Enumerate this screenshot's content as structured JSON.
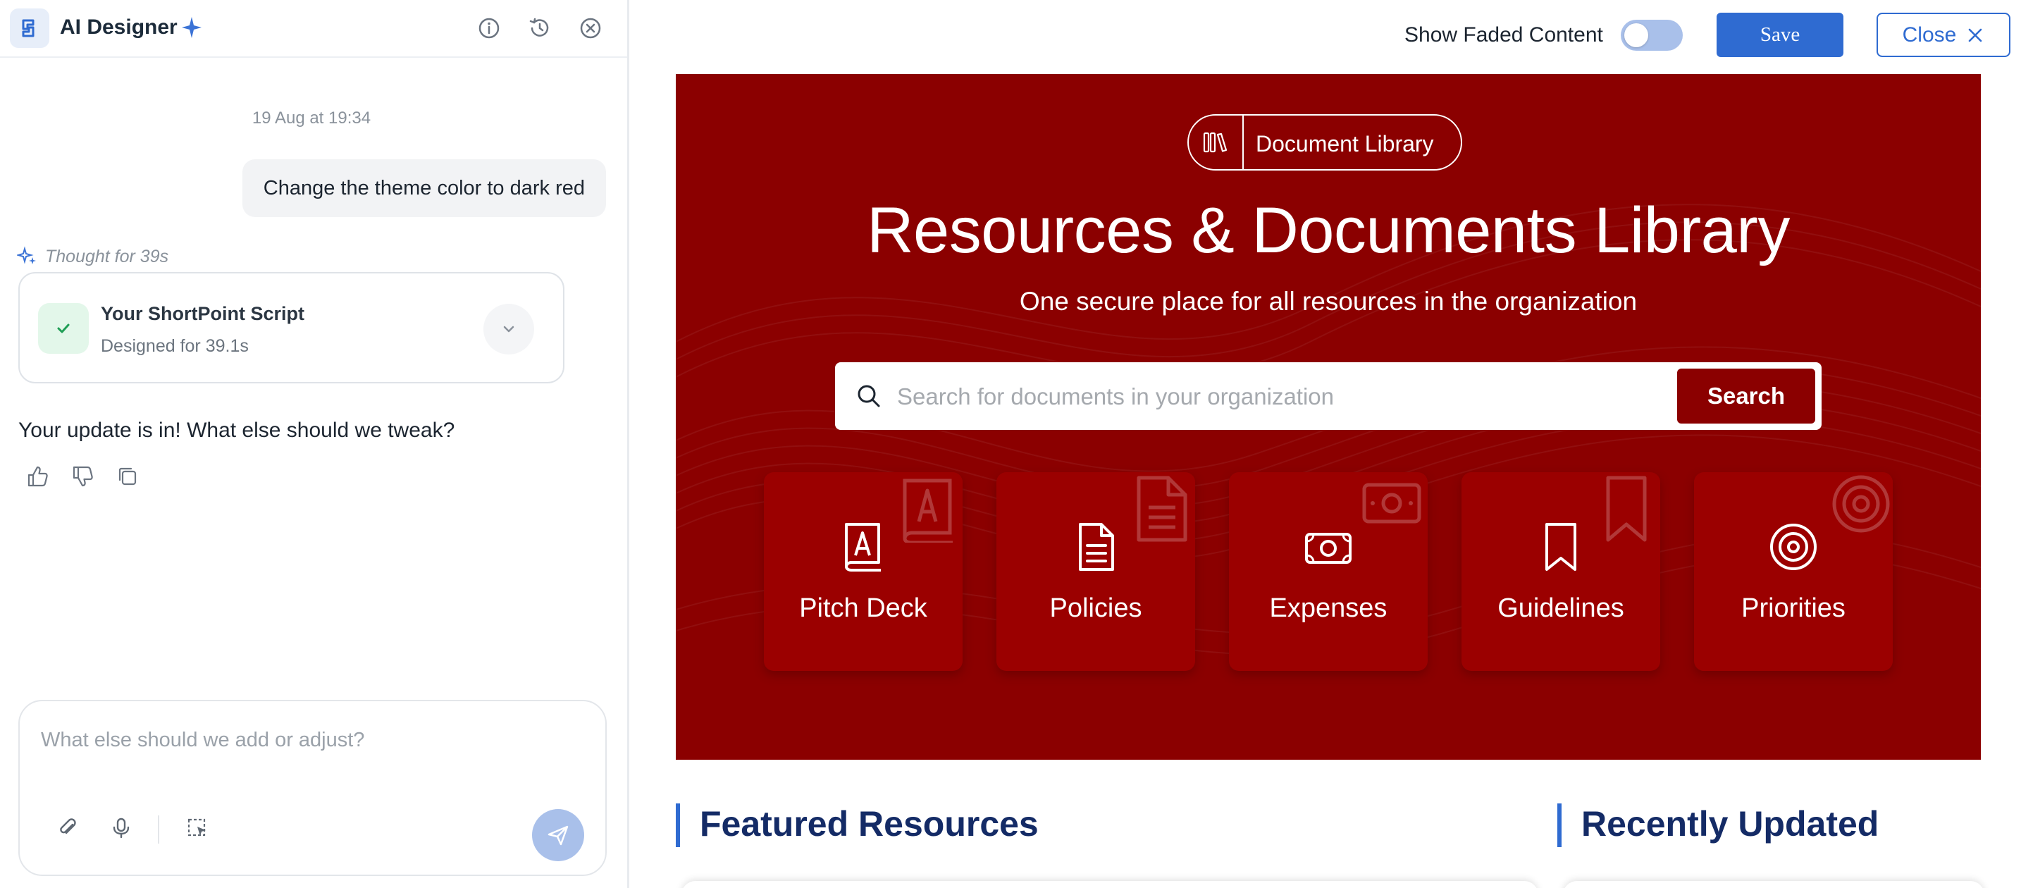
{
  "sidebar_panel": {
    "app_title": "AI Designer",
    "date_stamp": "19 Aug at 19:34",
    "user_message": "Change the theme color to dark red",
    "thought_label": "Thought for 39s",
    "script_card": {
      "title": "Your ShortPoint Script",
      "subtitle": "Designed for 39.1s"
    },
    "assistant_reply": "Your update is in! What else should we tweak?",
    "composer": {
      "placeholder": "What else should we add or adjust?"
    },
    "icons": {
      "header": [
        "info-icon",
        "history-icon",
        "close-circle-icon"
      ],
      "feedback": [
        "thumbs-up-icon",
        "thumbs-down-icon",
        "copy-icon"
      ],
      "composer": [
        "paperclip-icon",
        "microphone-icon",
        "select-area-icon",
        "send-icon"
      ]
    }
  },
  "toolbar": {
    "faded_label": "Show Faded Content",
    "faded_toggle_on": false,
    "save_label": "Save",
    "close_label": "Close"
  },
  "hero": {
    "pill_label": "Document Library",
    "title": "Resources & Documents Library",
    "subtitle": "One secure place for all resources in the organization",
    "search_placeholder": "Search for documents in your organization",
    "search_button": "Search",
    "tiles": [
      {
        "label": "Pitch Deck",
        "icon": "book-a-icon"
      },
      {
        "label": "Policies",
        "icon": "document-icon"
      },
      {
        "label": "Expenses",
        "icon": "money-icon"
      },
      {
        "label": "Guidelines",
        "icon": "bookmark-icon"
      },
      {
        "label": "Priorities",
        "icon": "target-icon"
      }
    ]
  },
  "sections": {
    "featured": "Featured Resources",
    "recent": "Recently Updated"
  },
  "colors": {
    "theme_dark_red": "#8b0000",
    "tile_red": "#9b0000",
    "accent_blue": "#2f6bd1",
    "section_title_navy": "#142b66"
  }
}
